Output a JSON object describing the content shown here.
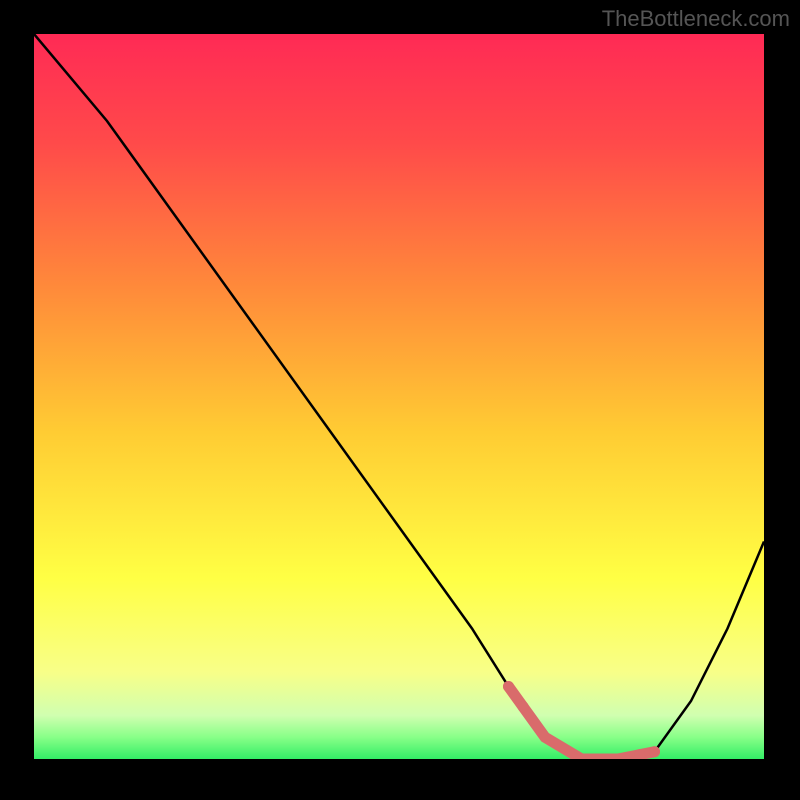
{
  "watermark": "TheBottleneck.com",
  "chart_data": {
    "type": "line",
    "title": "",
    "xlabel": "",
    "ylabel": "",
    "x": [
      0,
      10,
      20,
      30,
      40,
      50,
      60,
      65,
      70,
      75,
      80,
      85,
      90,
      95,
      100
    ],
    "y": [
      100,
      88,
      74,
      60,
      46,
      32,
      18,
      10,
      3,
      0,
      0,
      1,
      8,
      18,
      30
    ],
    "xlim": [
      0,
      100
    ],
    "ylim": [
      0,
      100
    ],
    "annotations": {
      "highlight_range_x": [
        65,
        85
      ],
      "highlight_color": "#d96b6b"
    },
    "gradient_stops": [
      {
        "offset": 0,
        "color": "#ff2a55"
      },
      {
        "offset": 15,
        "color": "#ff4a4a"
      },
      {
        "offset": 35,
        "color": "#ff8a3a"
      },
      {
        "offset": 55,
        "color": "#ffcc33"
      },
      {
        "offset": 75,
        "color": "#ffff44"
      },
      {
        "offset": 88,
        "color": "#f8ff88"
      },
      {
        "offset": 94,
        "color": "#d0ffb0"
      },
      {
        "offset": 97,
        "color": "#88ff88"
      },
      {
        "offset": 100,
        "color": "#33ee66"
      }
    ]
  }
}
